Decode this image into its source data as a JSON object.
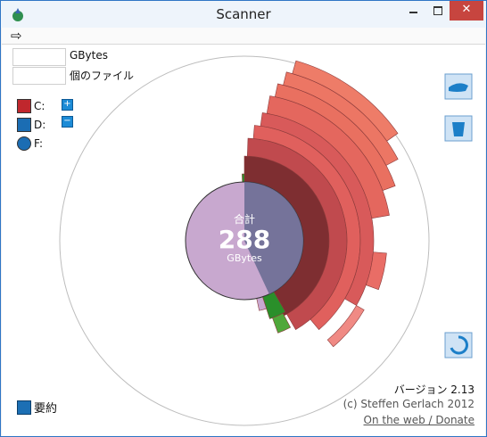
{
  "window": {
    "title": "Scanner"
  },
  "toolbar": {
    "back_icon": "arrow-right-icon"
  },
  "info": {
    "size_value": "",
    "size_unit": "GBytes",
    "files_value": "",
    "files_label": "個のファイル"
  },
  "drives": [
    {
      "label": "C:",
      "icon": "hard-drive-red-icon",
      "color": "#c0272d"
    },
    {
      "label": "D:",
      "icon": "hard-drive-blue-icon",
      "color": "#1b6db3"
    },
    {
      "label": "F:",
      "icon": "optical-drive-icon",
      "color": "#1b6db3"
    }
  ],
  "center": {
    "total_label": "合計",
    "total_value": "288",
    "unit": "GBytes"
  },
  "footer": {
    "version": "バージョン 2.13",
    "copyright": "(c) Steffen Gerlach 2012",
    "link": "On the web / Donate"
  },
  "summary": {
    "label": "要約"
  },
  "chart_data": {
    "type": "sunburst",
    "center_value_gb": 288,
    "segments_color_ring_1": [
      "#7e2e31",
      "#c04a4e",
      "#d85a5a"
    ],
    "colors": {
      "drive_red": "#e0605d",
      "green": "#2a8f2a",
      "lavender": "#c8a8cf",
      "slate": "#6c6d93"
    }
  }
}
